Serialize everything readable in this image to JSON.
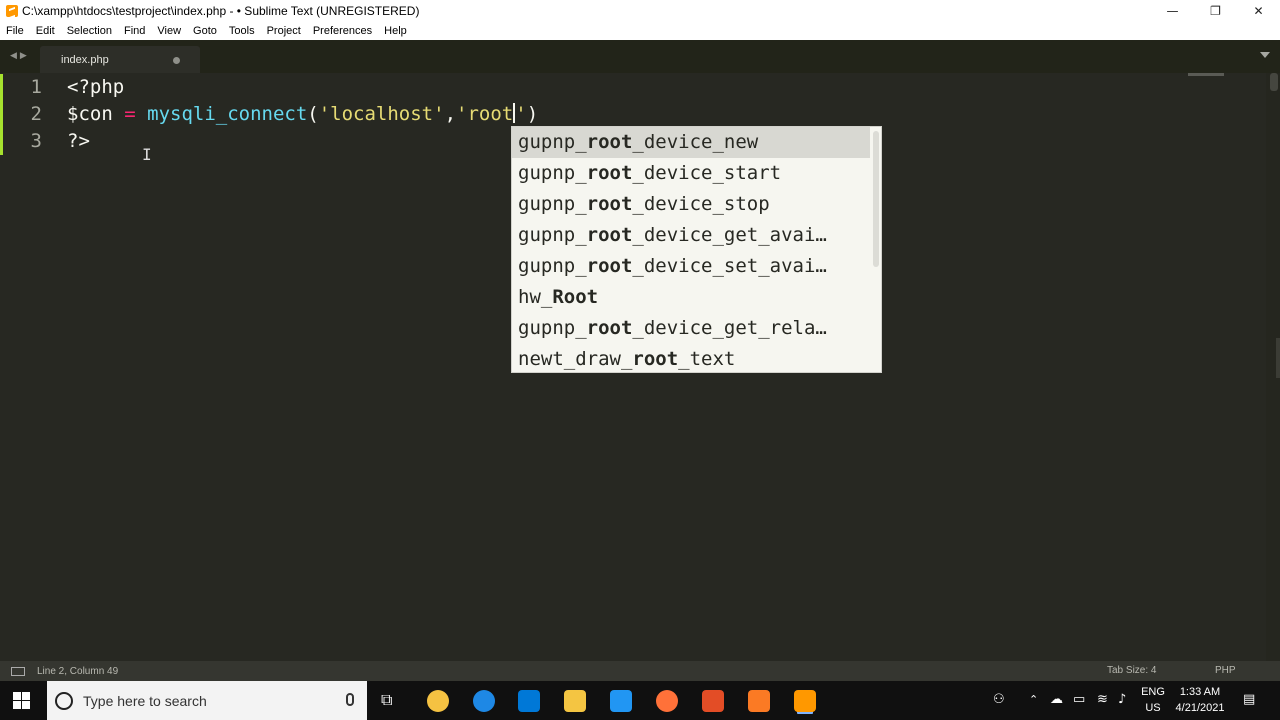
{
  "window": {
    "title": "C:\\xampp\\htdocs\\testproject\\index.php - • Sublime Text (UNREGISTERED)",
    "minimize": "—",
    "maximize": "❐",
    "close": "✕"
  },
  "menu": [
    "File",
    "Edit",
    "Selection",
    "Find",
    "View",
    "Goto",
    "Tools",
    "Project",
    "Preferences",
    "Help"
  ],
  "tabs": [
    {
      "label": "index.php",
      "modified": true
    }
  ],
  "editor": {
    "line_numbers": [
      "1",
      "2",
      "3"
    ],
    "line1": "<?php",
    "line2": {
      "var": "$con",
      "op": "=",
      "fn": "mysqli_connect",
      "open": "(",
      "str1": "'localhost'",
      "comma": ",",
      "str2": "'root",
      "str2_end": "'",
      "close": ")"
    },
    "line3": "?>"
  },
  "autocomplete": {
    "items": [
      {
        "pre": "gupnp_",
        "match": "root",
        "post": "_device_new"
      },
      {
        "pre": "gupnp_",
        "match": "root",
        "post": "_device_start"
      },
      {
        "pre": "gupnp_",
        "match": "root",
        "post": "_device_stop"
      },
      {
        "pre": "gupnp_",
        "match": "root",
        "post": "_device_get_avai…"
      },
      {
        "pre": "gupnp_",
        "match": "root",
        "post": "_device_set_avai…"
      },
      {
        "pre": "hw_",
        "match": "Root",
        "post": ""
      },
      {
        "pre": "gupnp_",
        "match": "root",
        "post": "_device_get_rela…"
      },
      {
        "pre": "newt_draw_",
        "match": "root",
        "post": "_text"
      }
    ]
  },
  "status": {
    "position": "Line 2, Column 49",
    "tab_size": "Tab Size: 4",
    "syntax": "PHP"
  },
  "taskbar": {
    "search_placeholder": "Type here to search",
    "lang": "ENG",
    "region": "US",
    "time": "1:33 AM",
    "date": "4/21/2021",
    "colors": {
      "chrome": "#f5c242",
      "edge": "#1e88e5",
      "store": "#0078d7",
      "explorer": "#f4c542",
      "mail": "#2196f3",
      "firefox": "#ff7139",
      "office": "#e34d26",
      "xampp": "#fb7a24",
      "sublime": "#ff9800"
    }
  }
}
